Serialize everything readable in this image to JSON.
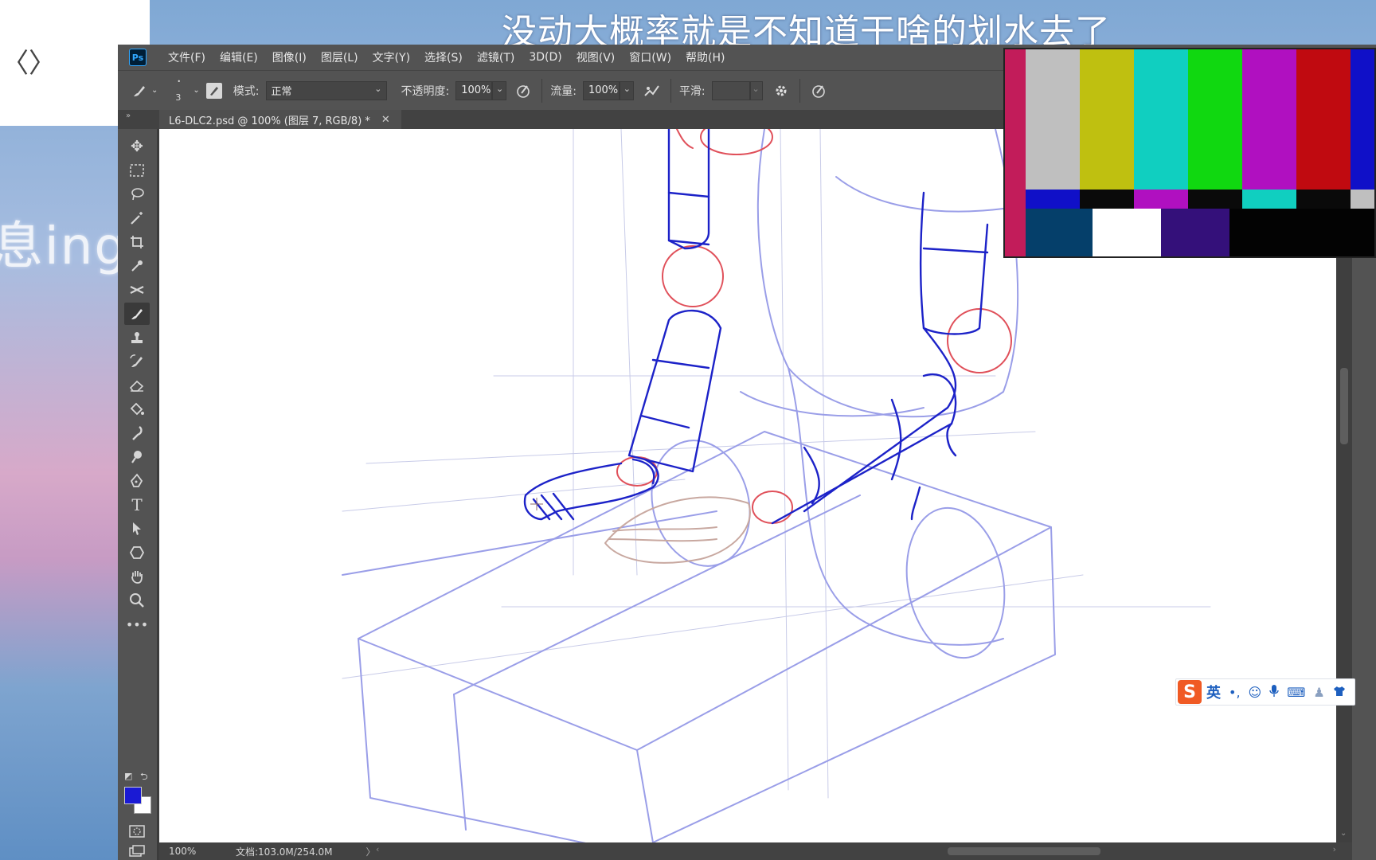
{
  "overlay": {
    "top_caption": "没动大概率就是不知道干啥的划水去了",
    "side_caption": "息ing~",
    "side_glyph": "〈〉"
  },
  "app": {
    "logo": "Ps",
    "menu": [
      "文件(F)",
      "编辑(E)",
      "图像(I)",
      "图层(L)",
      "文字(Y)",
      "选择(S)",
      "滤镜(T)",
      "3D(D)",
      "视图(V)",
      "窗口(W)",
      "帮助(H)"
    ]
  },
  "options": {
    "brush_size": "3",
    "mode_label": "模式:",
    "mode_value": "正常",
    "opacity_label": "不透明度:",
    "opacity_value": "100%",
    "flow_label": "流量:",
    "flow_value": "100%",
    "smoothing_label": "平滑:",
    "smoothing_value": ""
  },
  "document": {
    "tab_title": "L6-DLC2.psd @ 100% (图层 7, RGB/8) *",
    "close_glyph": "✕"
  },
  "status": {
    "zoom": "100%",
    "doc_info": "文档:103.0M/254.0M",
    "arrow": "〉"
  },
  "colors": {
    "foreground": "#1a1ad4",
    "background": "#ffffff",
    "sketch_blue": "#1c22c8",
    "sketch_light_blue": "#9a9ee8",
    "sketch_red": "#e0505a",
    "ps_panel": "#535353"
  },
  "tools": [
    "move-icon",
    "marquee-icon",
    "lasso-icon",
    "magic-wand-icon",
    "crop-icon",
    "eyedropper-icon",
    "healing-icon",
    "brush-icon",
    "stamp-icon",
    "history-brush-icon",
    "eraser-icon",
    "paint-bucket-icon",
    "smudge-icon",
    "dodge-icon",
    "pen-icon",
    "type-icon",
    "path-select-icon",
    "shape-icon",
    "hand-icon",
    "zoom-icon",
    "more-icon"
  ],
  "ime": {
    "logo": "S",
    "lang": "英"
  }
}
